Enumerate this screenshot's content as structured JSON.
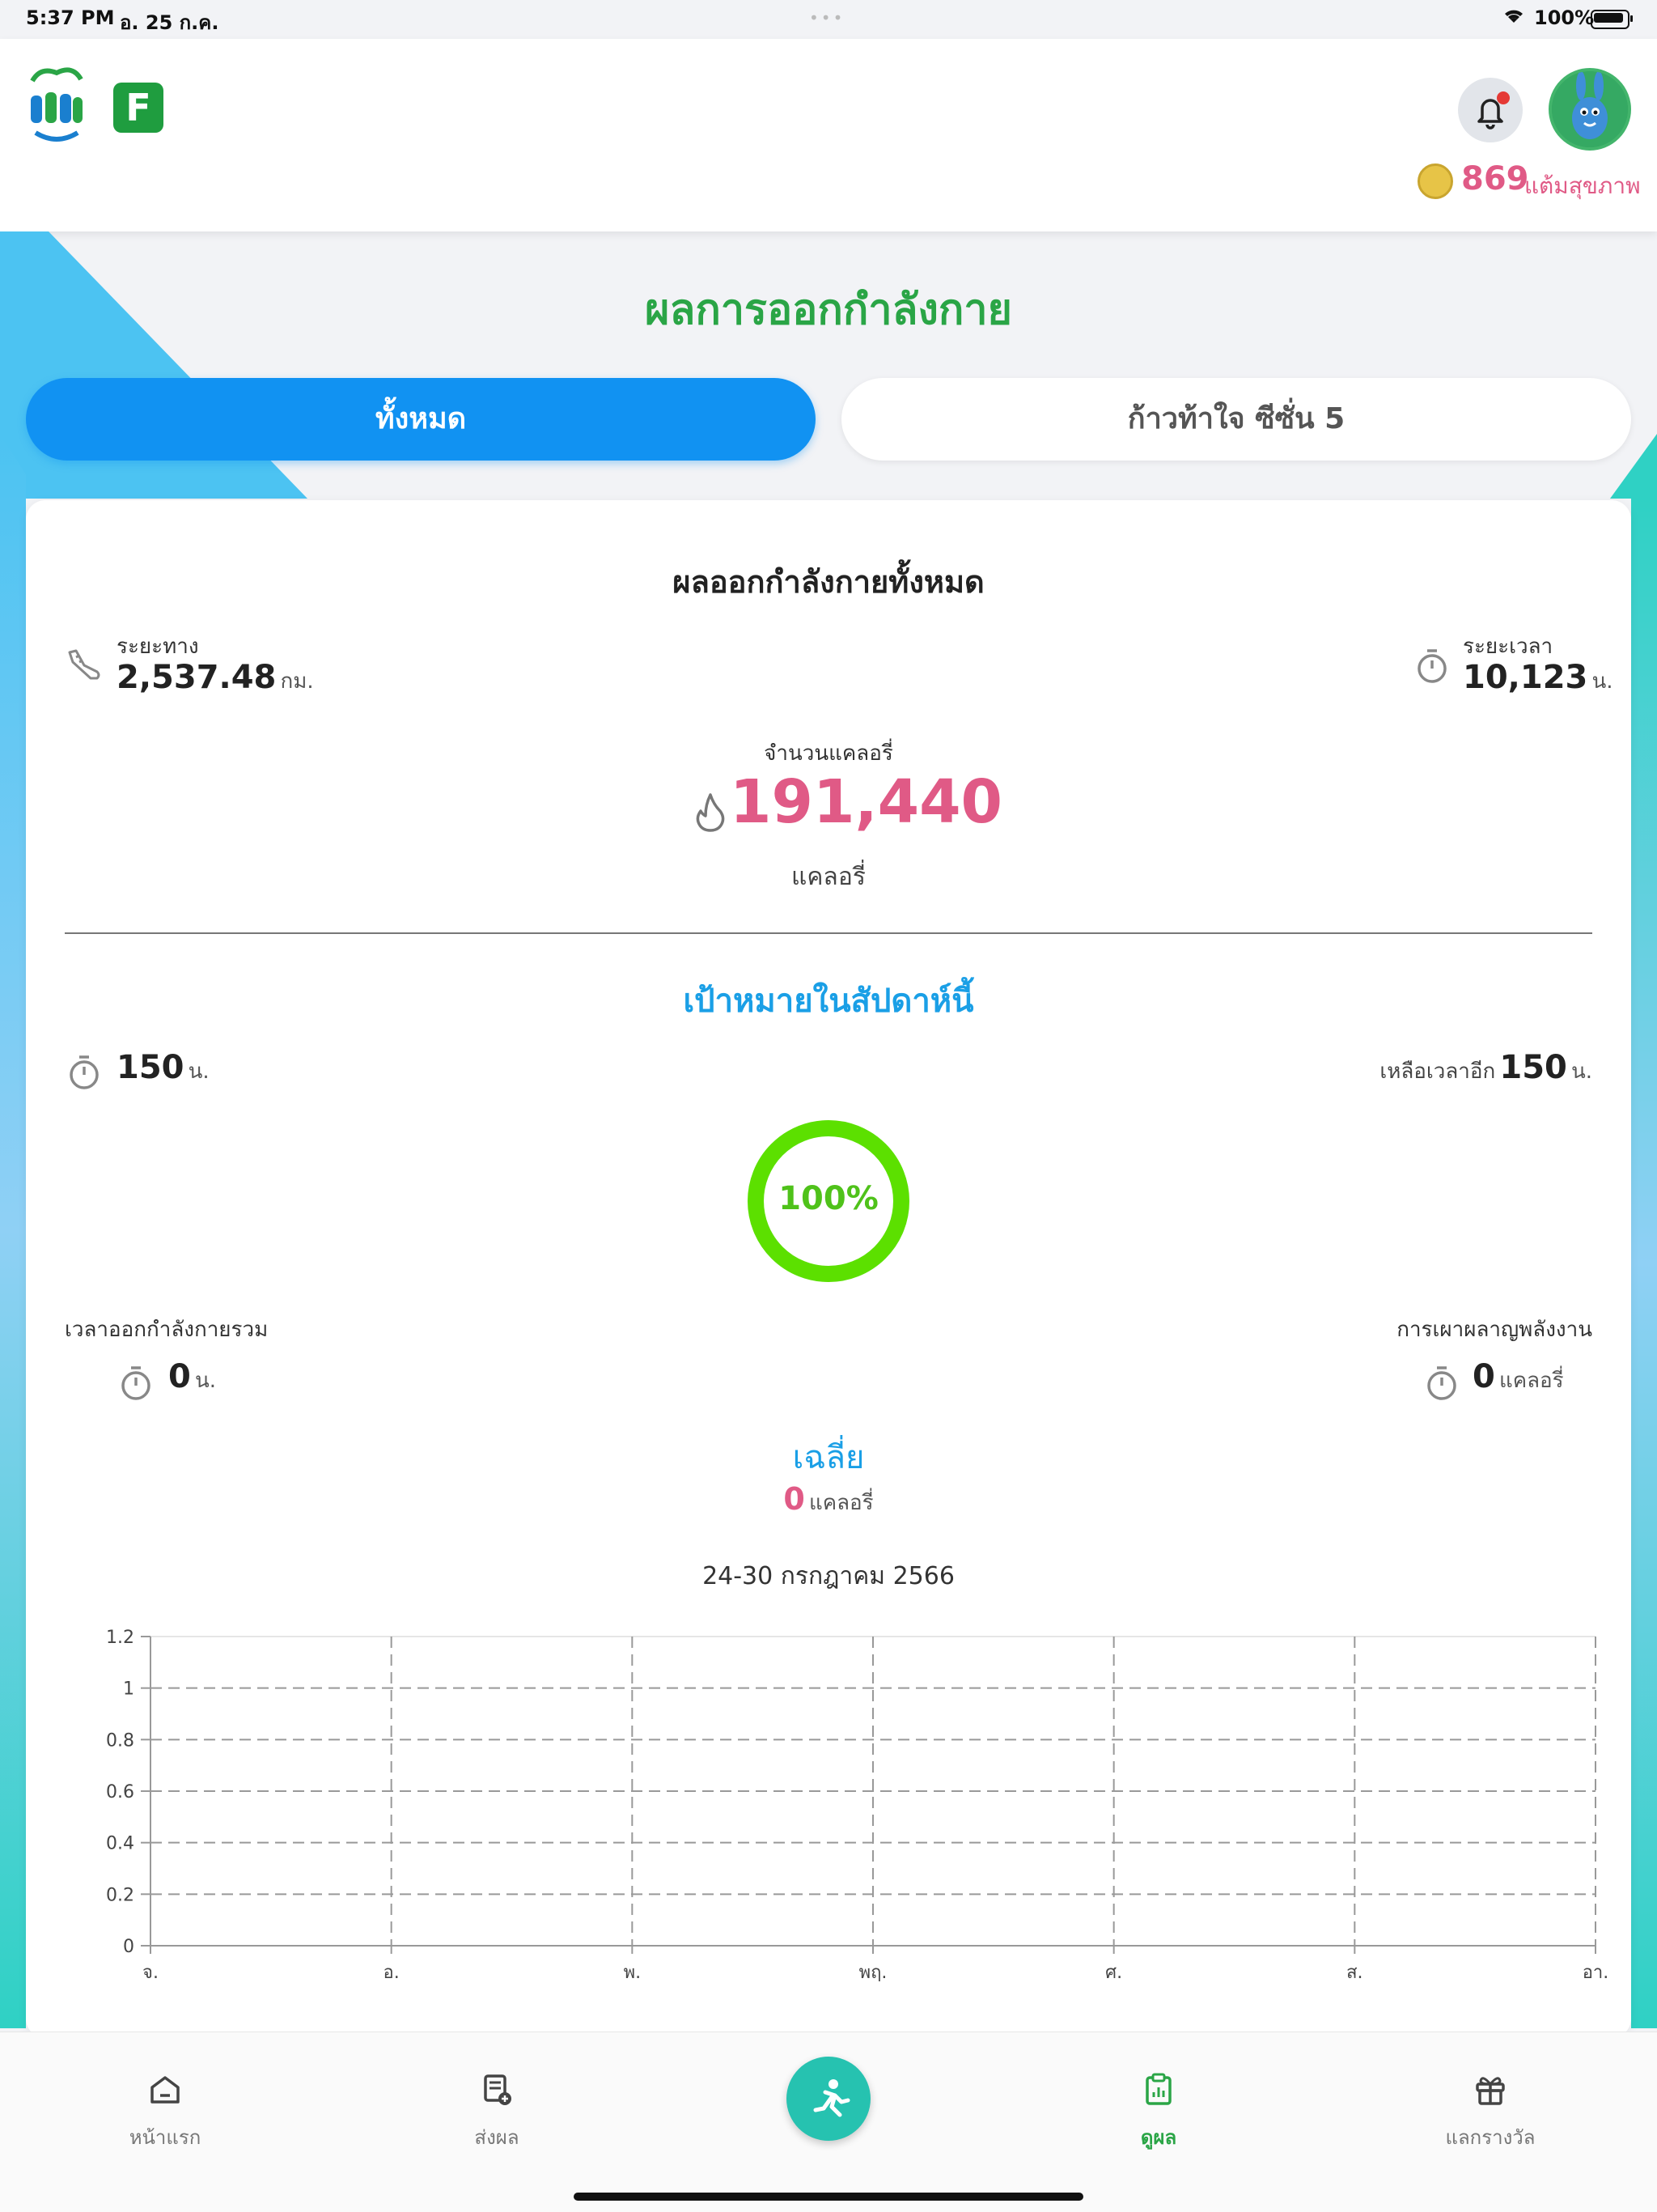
{
  "status_bar": {
    "time": "5:37 PM",
    "date": "อ. 25 ก.ค.",
    "battery": "100%"
  },
  "header": {
    "points_value": "869",
    "points_label": "แต้มสุขภาพ"
  },
  "page_title": "ผลการออกกำลังกาย",
  "tabs": [
    {
      "label": "ทั้งหมด",
      "active": true
    },
    {
      "label": "ก้าวท้าใจ ซีซั่น 5",
      "active": false
    }
  ],
  "summary": {
    "title": "ผลออกกำลังกายทั้งหมด",
    "distance": {
      "label": "ระยะทาง",
      "value": "2,537.48",
      "unit": "กม."
    },
    "duration": {
      "label": "ระยะเวลา",
      "value": "10,123",
      "unit": "น."
    },
    "calories": {
      "label": "จำนวนแคลอรี่",
      "value": "191,440",
      "unit": "แคลอรี่"
    }
  },
  "weekly_goal": {
    "title": "เป้าหมายในสัปดาห์นี้",
    "goal_value": "150",
    "goal_unit": "น.",
    "remaining_label": "เหลือเวลาอีก",
    "remaining_value": "150",
    "remaining_unit": "น.",
    "progress_text": "100%",
    "progress_fraction": 1.0,
    "total_time_label": "เวลาออกกำลังกายรวม",
    "total_time_value": "0",
    "total_time_unit": "น.",
    "burn_label": "การเผาผลาญพลังงาน",
    "burn_value": "0",
    "burn_unit": "แคลอรี่",
    "average_label": "เฉลี่ย",
    "average_value": "0",
    "average_unit": "แคลอรี่",
    "date_range": "24-30 กรกฎาคม 2566"
  },
  "colors": {
    "accent_blue": "#1192f2",
    "title_green": "#2aa546",
    "pink": "#e05a86",
    "ring_green": "#5ce000"
  },
  "chart_data": {
    "type": "line",
    "categories": [
      "จ.",
      "อ.",
      "พ.",
      "พฤ.",
      "ศ.",
      "ส.",
      "อา."
    ],
    "values": [
      0,
      0,
      0,
      0,
      0,
      0,
      0
    ],
    "ylim": [
      0,
      1.2
    ],
    "yticks": [
      "0",
      "0.2",
      "0.4",
      "0.6",
      "0.8",
      "1",
      "1.2"
    ],
    "grid": true,
    "title": "",
    "xlabel": "",
    "ylabel": ""
  },
  "bottom_nav": [
    {
      "label": "หน้าแรก",
      "icon": "home-icon",
      "active": false
    },
    {
      "label": "ส่งผล",
      "icon": "submit-result-icon",
      "active": false
    },
    {
      "label": "",
      "icon": "running-icon",
      "active": false
    },
    {
      "label": "ดูผล",
      "icon": "clipboard-chart-icon",
      "active": true
    },
    {
      "label": "แลกรางวัล",
      "icon": "gift-icon",
      "active": false
    }
  ]
}
